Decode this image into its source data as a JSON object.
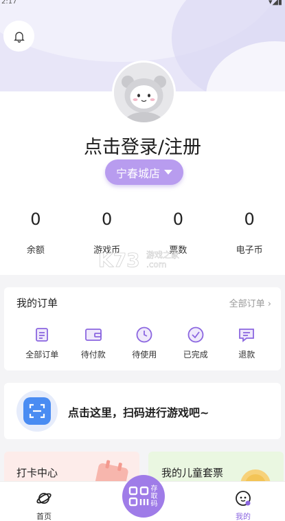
{
  "status": {
    "time": "2:17",
    "icons": "▾◢▮"
  },
  "header": {
    "store_name": "宁春城店",
    "login_text": "点击登录/注册"
  },
  "stats": [
    {
      "value": "0",
      "label": "余额"
    },
    {
      "value": "0",
      "label": "游戏币"
    },
    {
      "value": "0",
      "label": "票数"
    },
    {
      "value": "0",
      "label": "电子币"
    }
  ],
  "watermark": {
    "logo": "K73",
    "site": "游戏之家",
    "domain": ".com"
  },
  "orders": {
    "title": "我的订单",
    "all_link": "全部订单 ›",
    "items": [
      {
        "label": "全部订单",
        "icon": "list-icon"
      },
      {
        "label": "待付款",
        "icon": "wallet-icon"
      },
      {
        "label": "待使用",
        "icon": "clock-icon"
      },
      {
        "label": "已完成",
        "icon": "check-circle-icon"
      },
      {
        "label": "退款",
        "icon": "refund-icon"
      }
    ]
  },
  "scan": {
    "text": "点击这里，扫码进行游戏吧~"
  },
  "cards": {
    "checkin": "打卡中心",
    "kids_package": "我的儿童套票"
  },
  "tabbar": {
    "home": "首页",
    "center": "存取码",
    "mine": "我的"
  },
  "colors": {
    "accent": "#9f7ce8",
    "store_button": "#b89cef",
    "scan_blue": "#4a8cf2"
  }
}
